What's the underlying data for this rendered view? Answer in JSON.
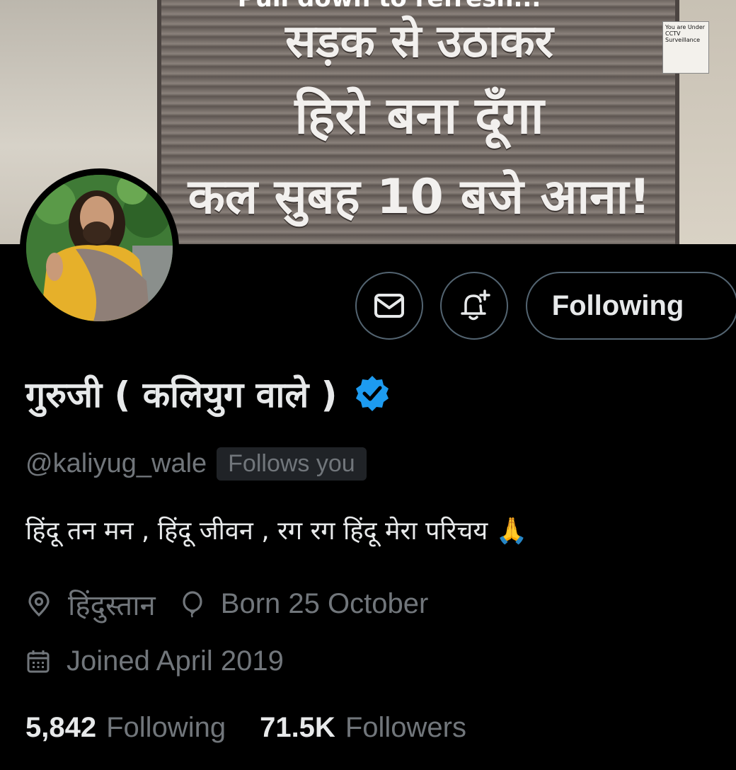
{
  "banner": {
    "caption": "Pull down to refresh...",
    "shutter_lines": [
      "सड़क से उठाकर",
      "हिरो बना दूँगा",
      "कल सुबह 10 बजे आना!"
    ],
    "notice": "You are Under CCTV Surveillance"
  },
  "actions": {
    "message_icon": "envelope-icon",
    "notify_icon": "bell-plus-icon",
    "following_label": "Following"
  },
  "profile": {
    "display_name": "गुरुजी ( कलियुग वाले )",
    "verified_icon": "verified-badge-icon",
    "handle": "@kaliyug_wale",
    "follows_you": "Follows you",
    "bio": "हिंदू तन मन , हिंदू जीवन , रग रग हिंदू मेरा परिचय 🙏",
    "location": "हिंदुस्तान",
    "birthday": "Born 25 October",
    "joined": "Joined April 2019",
    "following_count": "5,842",
    "following_label": "Following",
    "followers_count": "71.5K",
    "followers_label": "Followers"
  },
  "colors": {
    "background": "#000000",
    "text_primary": "#e7e9ea",
    "text_secondary": "#71767b",
    "border": "#536471",
    "verified_blue": "#1d9bf0"
  }
}
